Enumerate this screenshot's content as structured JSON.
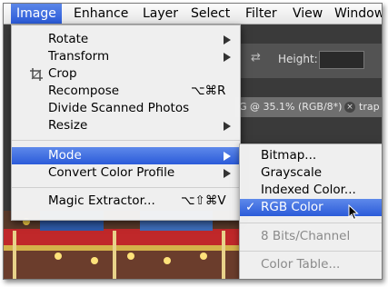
{
  "menubar": {
    "items": [
      {
        "label": "Image",
        "active": true
      },
      {
        "label": "Enhance"
      },
      {
        "label": "Layer"
      },
      {
        "label": "Select"
      },
      {
        "label": "Filter"
      },
      {
        "label": "View"
      },
      {
        "label": "Window"
      }
    ]
  },
  "background": {
    "height_label": "Height:",
    "doc_tab": "G @ 35.1% (RGB/8*)",
    "doc_tab2": "trap"
  },
  "image_menu": {
    "items": [
      {
        "label": "Rotate",
        "submenu": true
      },
      {
        "label": "Transform",
        "submenu": true
      },
      {
        "label": "Crop",
        "icon": "crop-icon"
      },
      {
        "label": "Recompose",
        "shortcut": "⌥⌘R"
      },
      {
        "label": "Divide Scanned Photos"
      },
      {
        "label": "Resize",
        "submenu": true
      },
      {
        "label": "Mode",
        "submenu": true,
        "highlighted": true
      },
      {
        "label": "Convert Color Profile",
        "submenu": true
      },
      {
        "label": "Magic Extractor...",
        "shortcut": "⌥⇧⌘V"
      }
    ]
  },
  "mode_menu": {
    "items": [
      {
        "label": "Bitmap..."
      },
      {
        "label": "Grayscale"
      },
      {
        "label": "Indexed Color..."
      },
      {
        "label": "RGB Color",
        "checked": true,
        "highlighted": true,
        "check_mark": "✓"
      },
      {
        "label": "8 Bits/Channel",
        "disabled": true
      },
      {
        "label": "Color Table...",
        "disabled": true
      }
    ]
  },
  "colors": {
    "highlight": "#2b5bd9",
    "disabled_text": "#8a8a8a"
  }
}
